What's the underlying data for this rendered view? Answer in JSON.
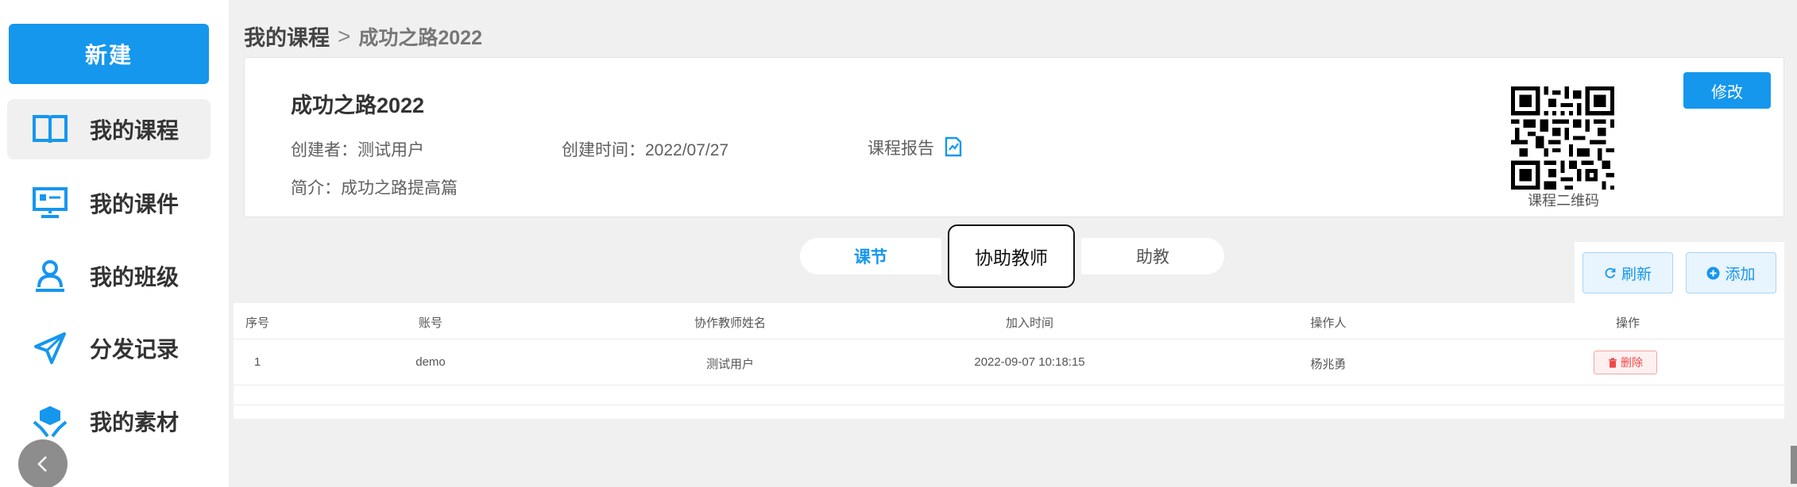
{
  "sidebar": {
    "new_label": "新建",
    "items": [
      {
        "label": "我的课程",
        "icon": "book-icon"
      },
      {
        "label": "我的课件",
        "icon": "presentation-icon"
      },
      {
        "label": "我的班级",
        "icon": "class-user-icon"
      },
      {
        "label": "分发记录",
        "icon": "send-icon"
      },
      {
        "label": "我的素材",
        "icon": "material-icon"
      }
    ]
  },
  "breadcrumb": {
    "root": "我的课程",
    "separator": ">",
    "current": "成功之路2022"
  },
  "course": {
    "title": "成功之路2022",
    "creator": "创建者：测试用户",
    "created_at": "创建时间：2022/07/27",
    "report": "课程报告",
    "intro": "简介：成功之路提高篇",
    "edit_label": "修改",
    "qr_label": "课程二维码"
  },
  "tabs": [
    {
      "label": "课节",
      "state": "inactive-highlight"
    },
    {
      "label": "协助教师",
      "state": "selected"
    },
    {
      "label": "助教",
      "state": "inactive"
    }
  ],
  "actions": {
    "refresh_label": "刷新",
    "add_label": "添加"
  },
  "table": {
    "headers": [
      "序号",
      "账号",
      "协作教师姓名",
      "加入时间",
      "操作人",
      "操作"
    ],
    "rows": [
      {
        "index": "1",
        "account": "demo",
        "name": "测试用户",
        "joined": "2022-09-07 10:18:15",
        "operator": "杨兆勇",
        "delete_label": "删除"
      }
    ]
  },
  "colors": {
    "primary": "#1597ee",
    "danger": "#f04848"
  }
}
